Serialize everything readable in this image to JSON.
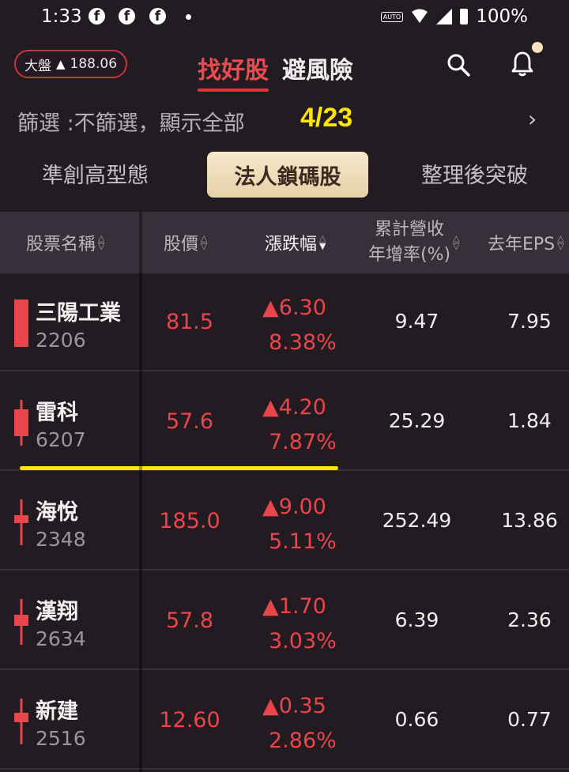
{
  "status_bar": {
    "time": "1:33",
    "auto_label": "AUTO",
    "battery": "100%"
  },
  "top_nav": {
    "index_label": "大盤",
    "index_value": "188.06",
    "tab_find": "找好股",
    "tab_risk": "避風險"
  },
  "filter": {
    "text": "篩選 :不篩選，顯示全部",
    "date": "4/23"
  },
  "categories": [
    "準創高型態",
    "法人鎖碼股",
    "整理後突破"
  ],
  "selected_category": "法人鎖碼股",
  "table_header": {
    "name": "股票名稱",
    "price": "股價",
    "change": "漲跌幅",
    "revenue_line1": "累計營收",
    "revenue_line2": "年增率(%)",
    "eps": "去年EPS"
  },
  "rows": [
    {
      "name": "三陽工業",
      "code": "2206",
      "price": "81.5",
      "change": "6.30",
      "change_pct": "8.38%",
      "revenue_growth": "9.47",
      "eps": "7.95"
    },
    {
      "name": "雷科",
      "code": "6207",
      "price": "57.6",
      "change": "4.20",
      "change_pct": "7.87%",
      "revenue_growth": "25.29",
      "eps": "1.84"
    },
    {
      "name": "海悅",
      "code": "2348",
      "price": "185.0",
      "change": "9.00",
      "change_pct": "5.11%",
      "revenue_growth": "252.49",
      "eps": "13.86"
    },
    {
      "name": "漢翔",
      "code": "2634",
      "price": "57.8",
      "change": "1.70",
      "change_pct": "3.03%",
      "revenue_growth": "6.39",
      "eps": "2.36"
    },
    {
      "name": "新建",
      "code": "2516",
      "price": "12.60",
      "change": "0.35",
      "change_pct": "2.86%",
      "revenue_growth": "0.66",
      "eps": "0.77"
    }
  ],
  "colors": {
    "up": "#e8464b",
    "accent": "#ffe600",
    "background": "#231b22"
  }
}
